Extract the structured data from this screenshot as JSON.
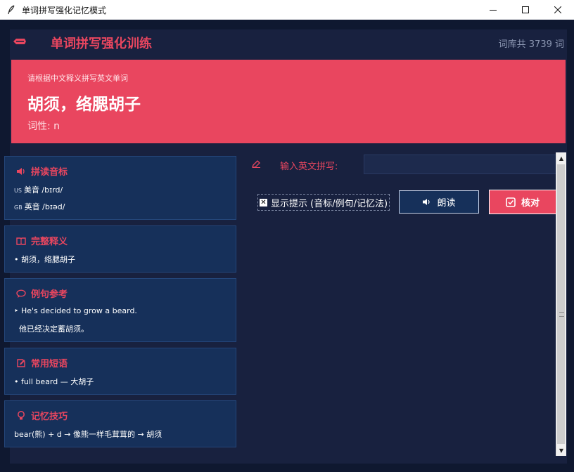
{
  "window": {
    "title": "单词拼写强化记忆模式",
    "icon": "feather-icon",
    "controls": [
      "minimize-icon",
      "maximize-icon",
      "close-icon"
    ]
  },
  "header": {
    "logo_icon": "pencil-icon",
    "title": "单词拼写强化训练",
    "count": "词库共 3739 词"
  },
  "banner": {
    "hint": "请根据中文释义拼写英文单词",
    "meaning": "胡须，络腮胡子",
    "pos": "词性: n"
  },
  "cards": {
    "phonetic": {
      "title": "拼读音标",
      "icon": "speaker-icon",
      "us_tag": "US",
      "us_label": "美音 /bɪrd/",
      "gb_tag": "GB",
      "gb_label": "英音 /bɪəd/"
    },
    "definition": {
      "title": "完整释义",
      "icon": "book-icon",
      "line": "• 胡须，络腮胡子"
    },
    "example": {
      "title": "例句参考",
      "icon": "speech-bubble-icon",
      "en": "‣ He's decided to grow a beard.",
      "zh": "他已经决定蓄胡须。"
    },
    "phrase": {
      "title": "常用短语",
      "icon": "edit-icon",
      "line": "• full beard — 大胡子"
    },
    "memory": {
      "title": "记忆技巧",
      "icon": "lightbulb-icon",
      "line": "bear(熊) + d → 像熊一样毛茸茸的 → 胡须"
    }
  },
  "practice": {
    "input_label": "输入英文拼写:",
    "input_value": "",
    "show_hint_label": "显示提示 (音标/例句/记忆法)",
    "show_hint_checked": true,
    "read_button": "朗读",
    "check_button": "核对"
  },
  "colors": {
    "accent": "#e9465f",
    "background": "#18213f",
    "card": "#16305a"
  }
}
